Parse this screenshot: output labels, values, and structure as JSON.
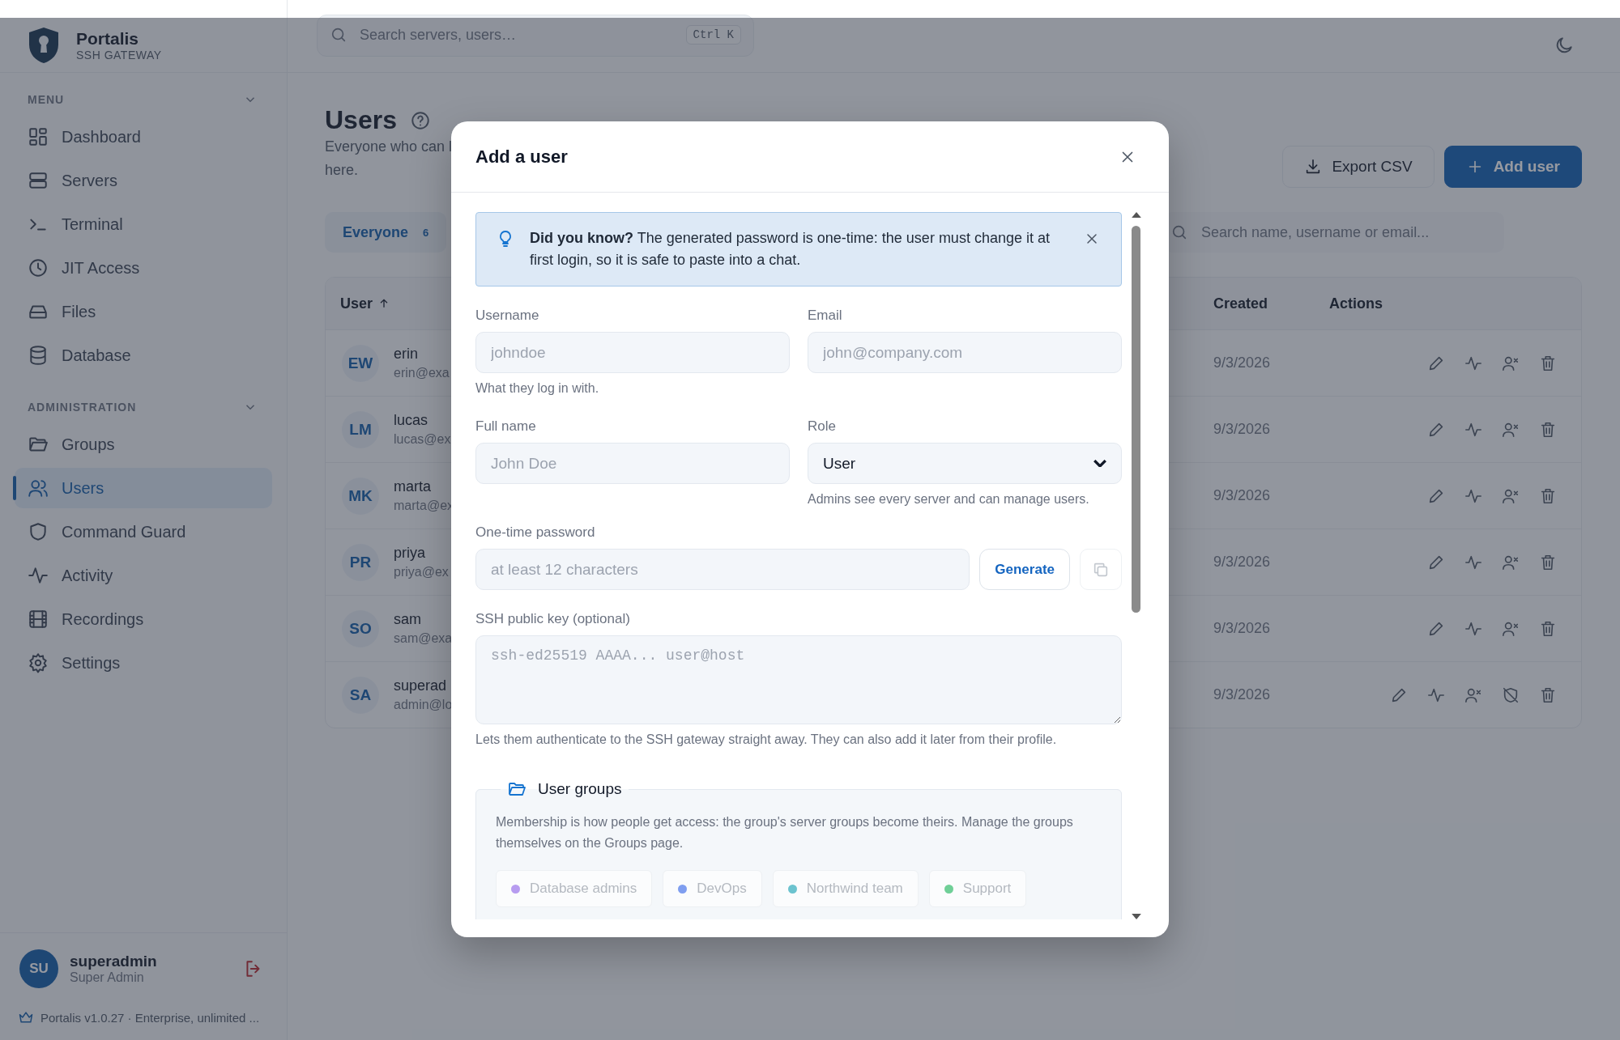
{
  "app": {
    "name": "Portalis",
    "tagline": "SSH GATEWAY"
  },
  "header": {
    "search": {
      "placeholder": "Search servers, users…",
      "shortcut": "Ctrl K"
    }
  },
  "sidebar": {
    "sections": [
      {
        "title": "MENU",
        "expanded": true,
        "items": [
          {
            "label": "Dashboard",
            "selected": false
          },
          {
            "label": "Servers",
            "selected": false
          },
          {
            "label": "Terminal",
            "selected": false
          },
          {
            "label": "JIT Access",
            "selected": false
          },
          {
            "label": "Files",
            "selected": false
          },
          {
            "label": "Database",
            "selected": false
          }
        ]
      },
      {
        "title": "ADMINISTRATION",
        "expanded": true,
        "items": [
          {
            "label": "Groups",
            "selected": false
          },
          {
            "label": "Users",
            "selected": true
          },
          {
            "label": "Command Guard",
            "selected": false
          },
          {
            "label": "Activity",
            "selected": false
          },
          {
            "label": "Recordings",
            "selected": false
          },
          {
            "label": "Settings",
            "selected": false
          }
        ]
      }
    ],
    "user": {
      "initials": "SU",
      "name": "superadmin",
      "role": "Super Admin"
    },
    "footer": "Portalis v1.0.27 · Enterprise, unlimited ..."
  },
  "page": {
    "title": "Users",
    "subtitle_lines": [
      "Everyone who can l",
      "here."
    ],
    "buttons": [
      {
        "label": "Export CSV",
        "kind": "secondary"
      },
      {
        "label": "Add user",
        "kind": "primary"
      }
    ],
    "filters": [
      {
        "label": "Everyone",
        "count": "6",
        "selected": true
      }
    ],
    "search": {
      "placeholder": "Search name, username or email..."
    }
  },
  "table": {
    "columns": [
      {
        "label": "User",
        "sorted": true
      },
      {
        "label": "Created",
        "sorted": false
      },
      {
        "label": "Actions",
        "sorted": false
      }
    ],
    "rows": [
      {
        "initials": "EW",
        "name": "erin",
        "email": "erin@exa",
        "created": "9/3/2026",
        "kind": "user"
      },
      {
        "initials": "LM",
        "name": "lucas",
        "email": "lucas@ex",
        "created": "9/3/2026",
        "kind": "user"
      },
      {
        "initials": "MK",
        "name": "marta",
        "email": "marta@ex",
        "created": "9/3/2026",
        "kind": "user"
      },
      {
        "initials": "PR",
        "name": "priya",
        "email": "priya@ex",
        "created": "9/3/2026",
        "kind": "user"
      },
      {
        "initials": "SO",
        "name": "sam",
        "email": "sam@exa",
        "created": "9/3/2026",
        "kind": "user"
      },
      {
        "initials": "SA",
        "name": "superad",
        "email": "admin@lo",
        "created": "9/3/2026",
        "kind": "admin"
      }
    ]
  },
  "modal": {
    "title": "Add a user",
    "tip": "**Did you know?** The generated password is one-time: the user must change it at first login, so it is safe to paste into a chat.",
    "fields": [
      {
        "label": "Username",
        "kind": "text",
        "placeholder": "johndoe",
        "help": "What they log in with."
      },
      {
        "label": "Email",
        "kind": "text",
        "placeholder": "john@company.com"
      },
      {
        "label": "Full name",
        "kind": "text",
        "placeholder": "John Doe"
      },
      {
        "label": "Role",
        "kind": "select",
        "value": "User",
        "help": "Admins see every server and can manage users."
      }
    ],
    "password": {
      "label": "One-time password",
      "placeholder": "at least 12 characters",
      "generate": "Generate"
    },
    "ssh_key": {
      "label": "SSH public key (optional)",
      "placeholder": "ssh-ed25519 AAAA... user@host",
      "help": "Lets them authenticate to the SSH gateway straight away. They can also add it later from their profile."
    },
    "groups": {
      "title": "User groups",
      "description": "Membership is how people get access: the group's server groups become theirs. Manage the groups themselves on the Groups page.",
      "chips": [
        {
          "label": "Database admins",
          "color": "#b79cf0"
        },
        {
          "label": "DevOps",
          "color": "#7f9ef0"
        },
        {
          "label": "Northwind team",
          "color": "#6cc3cf"
        },
        {
          "label": "Support",
          "color": "#6fcf97"
        }
      ]
    }
  }
}
